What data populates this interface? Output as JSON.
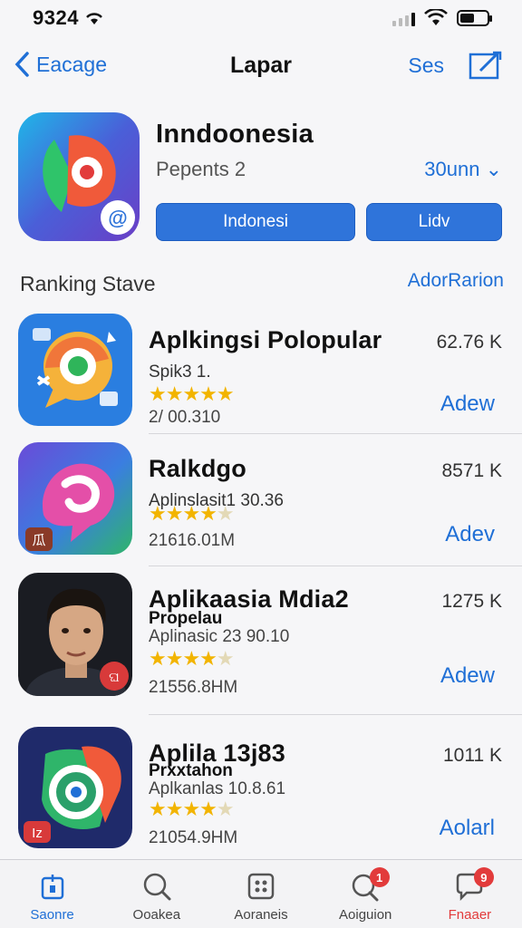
{
  "status": {
    "time": "9324"
  },
  "nav": {
    "back_label": "Eacage",
    "title": "Lapar",
    "right_label": "Ses"
  },
  "hero": {
    "title": "Inndoonesia",
    "subtitle": "Pepents 2",
    "size": "30unn",
    "primary_button": "Indonesi",
    "secondary_button": "Lidv"
  },
  "section": {
    "title": "Ranking Stave",
    "link": "AdorRarion"
  },
  "apps": [
    {
      "name": "Aplkingsi Polopular",
      "sub1": "Spik3 1.",
      "sub2": "",
      "rating": 5,
      "meta": "2/ 00.310",
      "size": "62.76 K",
      "action": "Adew"
    },
    {
      "name": "Ralkdgo",
      "sub1": "Aplinslasit1 30.36",
      "sub2": "",
      "rating": 4.5,
      "meta": "21616.01M",
      "size": "8571 K",
      "action": "Adev"
    },
    {
      "name": "Aplikaasia Mdia2",
      "sub1": "Propelau",
      "sub2": "Aplinasic 23 90.10",
      "rating": 4.5,
      "meta": "21556.8HM",
      "size": "1275 K",
      "action": "Adew"
    },
    {
      "name": "Aplila 13j83",
      "sub1": "Prxxtahon",
      "sub2": "Aplkanlas 10.8.61",
      "rating": 4.5,
      "meta": "21054.9HM",
      "size": "1011 K",
      "action": "Aolarl"
    }
  ],
  "tabs": [
    {
      "label": "Saonre",
      "icon": "store-icon"
    },
    {
      "label": "Ooakea",
      "icon": "search-icon"
    },
    {
      "label": "Aoraneis",
      "icon": "apps-icon"
    },
    {
      "label": "Aoiguion",
      "icon": "updates-icon",
      "badge": "1"
    },
    {
      "label": "Fnaaer",
      "icon": "chat-icon",
      "badge": "9"
    }
  ],
  "colors": {
    "accent": "#1f6fd6",
    "button": "#2f74da",
    "star": "#f2b400",
    "alert": "#e23b3b"
  }
}
